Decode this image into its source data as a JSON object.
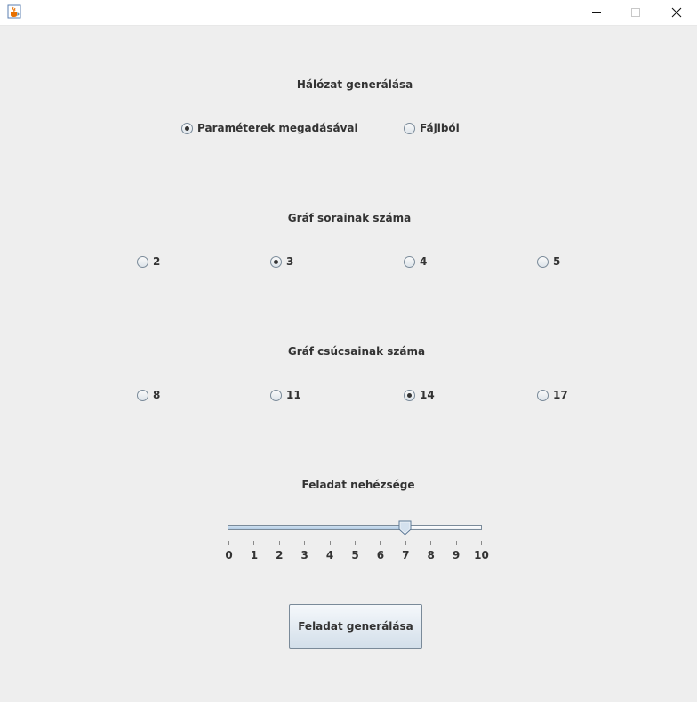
{
  "window": {
    "minimize_icon": "minimize-icon",
    "maximize_icon": "maximize-icon",
    "close_icon": "close-icon",
    "app_icon": "java-cup-icon"
  },
  "network": {
    "heading": "Hálózat generálása",
    "options": [
      "Paraméterek megadásával",
      "Fájlból"
    ],
    "selected": "Paraméterek megadásával"
  },
  "rows": {
    "heading": "Gráf sorainak száma",
    "options": [
      "2",
      "3",
      "4",
      "5"
    ],
    "selected": "3"
  },
  "vertices": {
    "heading": "Gráf csúcsainak száma",
    "options": [
      "8",
      "11",
      "14",
      "17"
    ],
    "selected": "14"
  },
  "difficulty": {
    "heading": "Feladat nehézsége",
    "min": 0,
    "max": 10,
    "value": 7,
    "tick_labels": [
      "0",
      "1",
      "2",
      "3",
      "4",
      "5",
      "6",
      "7",
      "8",
      "9",
      "10"
    ]
  },
  "generate_button": {
    "label": "Feladat generálása"
  },
  "colors": {
    "background": "#eeeeee",
    "text": "#333333",
    "border": "#7a8a99"
  }
}
